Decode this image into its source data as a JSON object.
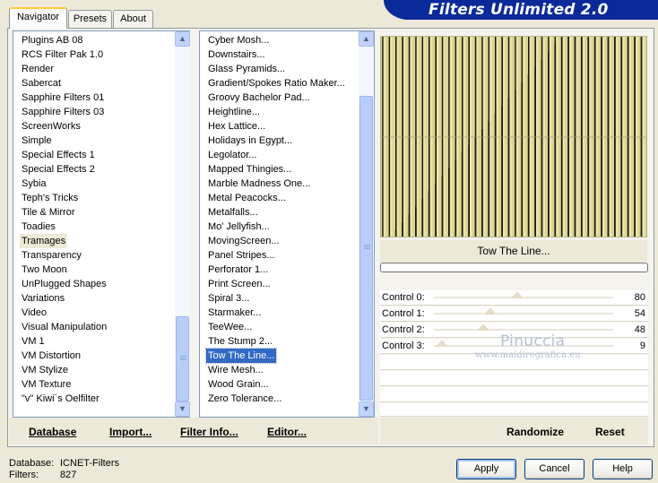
{
  "header": {
    "title": "Filters Unlimited 2.0"
  },
  "tabs": [
    {
      "label": "Navigator",
      "active": true
    },
    {
      "label": "Presets",
      "active": false
    },
    {
      "label": "About",
      "active": false
    }
  ],
  "categories": {
    "items": [
      "Plugins AB 08",
      "RCS Filter Pak 1.0",
      "Render",
      "Sabercat",
      "Sapphire Filters 01",
      "Sapphire Filters 03",
      "ScreenWorks",
      "Simple",
      "Special Effects 1",
      "Special Effects 2",
      "Sybia",
      "Teph's Tricks",
      "Tile & Mirror",
      "Toadies",
      "Tramages",
      "Transparency",
      "Two Moon",
      "UnPlugged Shapes",
      "Variations",
      "Video",
      "Visual Manipulation",
      "VM 1",
      "VM Distortion",
      "VM Stylize",
      "VM Texture",
      "\"v\" Kiwi`s Oelfilter"
    ],
    "selected": "Tramages"
  },
  "filters": {
    "items": [
      "Cyber Mosh...",
      "Downstairs...",
      "Glass Pyramids...",
      "Gradient/Spokes Ratio Maker...",
      "Groovy Bachelor Pad...",
      "Heightline...",
      "Hex Lattice...",
      "Holidays in Egypt...",
      "Legolator...",
      "Mapped Thingies...",
      "Marble Madness One...",
      "Metal Peacocks...",
      "Metalfalls...",
      "Mo' Jellyfish...",
      "MovingScreen...",
      "Panel Stripes...",
      "Perforator 1...",
      "Print Screen...",
      "Spiral 3...",
      "Starmaker...",
      "TeeWee...",
      "The Stump 2...",
      "Tow The Line...",
      "Wire Mesh...",
      "Wood Grain...",
      "Zero Tolerance..."
    ],
    "selected": "Tow The Line..."
  },
  "bottom_links": {
    "database": "Database",
    "import": "Import...",
    "filter_info": "Filter Info...",
    "editor": "Editor..."
  },
  "preview": {
    "filter_name": "Tow The Line..."
  },
  "controls": [
    {
      "label": "Control 0:",
      "value": "80"
    },
    {
      "label": "Control 1:",
      "value": "54"
    },
    {
      "label": "Control 2:",
      "value": "48"
    },
    {
      "label": "Control 3:",
      "value": "9"
    }
  ],
  "actions": {
    "randomize": "Randomize",
    "reset": "Reset"
  },
  "watermark": {
    "line1": "Pinuccia",
    "line2": "www.maidiregrafica.eu"
  },
  "status": {
    "database_label": "Database:",
    "database_value": "ICNET-Filters",
    "filters_label": "Filters:",
    "filters_value": "827"
  },
  "buttons": {
    "apply": "Apply",
    "cancel": "Cancel",
    "help": "Help"
  },
  "colors": {
    "accent": "#316ac5",
    "banner": "#0a2a9a",
    "preview_bg": "#ddd592",
    "tab_highlight": "#ffc83c"
  }
}
